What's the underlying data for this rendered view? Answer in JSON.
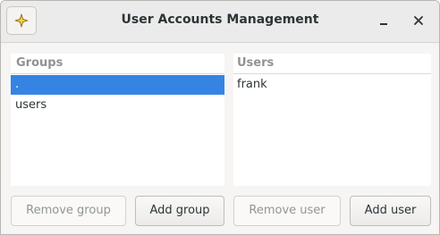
{
  "window": {
    "title": "User Accounts Management",
    "minimize_glyph": "minimize-icon",
    "close_glyph": "close-icon",
    "app_icon": "sparkle-icon",
    "accent_color": "#3584e4"
  },
  "groups": {
    "header": "Groups",
    "items": [
      {
        "label": ".",
        "selected": true
      },
      {
        "label": "users",
        "selected": false
      }
    ],
    "remove_button": "Remove group",
    "add_button": "Add group"
  },
  "users": {
    "header": "Users",
    "items": [
      {
        "label": "frank",
        "selected": false
      }
    ],
    "remove_button": "Remove user",
    "add_button": "Add user"
  }
}
